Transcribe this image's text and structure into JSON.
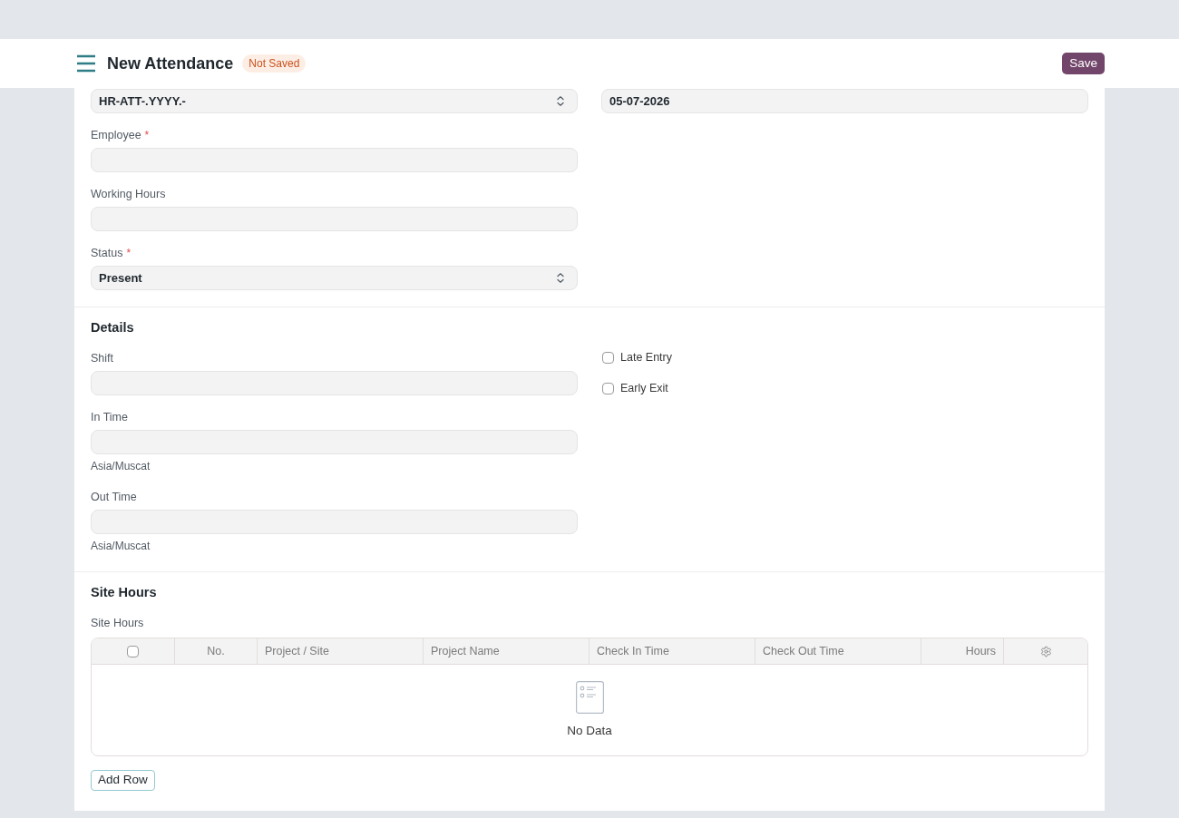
{
  "header": {
    "title": "New Attendance",
    "status_badge": "Not Saved",
    "save_button": "Save"
  },
  "sections": [
    {
      "columns": [
        [
          {
            "kind": "select",
            "value": "HR-ATT-.YYYY.-"
          },
          {
            "kind": "input",
            "label": "Employee",
            "required_mark": "*"
          },
          {
            "kind": "input",
            "label": "Working Hours"
          },
          {
            "kind": "select",
            "label": "Status",
            "required_mark": "*",
            "value": "Present"
          }
        ],
        [
          {
            "kind": "input",
            "value": "05-07-2026"
          }
        ]
      ]
    },
    {
      "heading": "Details",
      "columns": [
        [
          {
            "kind": "input",
            "label": "Shift"
          },
          {
            "kind": "input",
            "label": "In Time",
            "description": "Asia/Muscat"
          },
          {
            "kind": "input",
            "label": "Out Time",
            "description": "Asia/Muscat"
          }
        ],
        [
          {
            "kind": "checkbox",
            "label": "Late Entry",
            "checked": false
          },
          {
            "kind": "checkbox",
            "label": "Early Exit",
            "checked": false
          }
        ]
      ]
    },
    {
      "heading": "Site Hours",
      "table": {
        "label": "Site Hours",
        "select_all": {
          "checked": false
        },
        "columns": [
          {
            "label": "No.",
            "kind": "index"
          },
          {
            "label": "Project / Site",
            "kind": "text"
          },
          {
            "label": "Project Name",
            "kind": "text"
          },
          {
            "label": "Check In Time",
            "kind": "text"
          },
          {
            "label": "Check Out Time",
            "kind": "text"
          },
          {
            "label": "Hours",
            "kind": "number"
          }
        ],
        "empty_text": "No Data",
        "add_row_button": "Add Row"
      }
    }
  ]
}
